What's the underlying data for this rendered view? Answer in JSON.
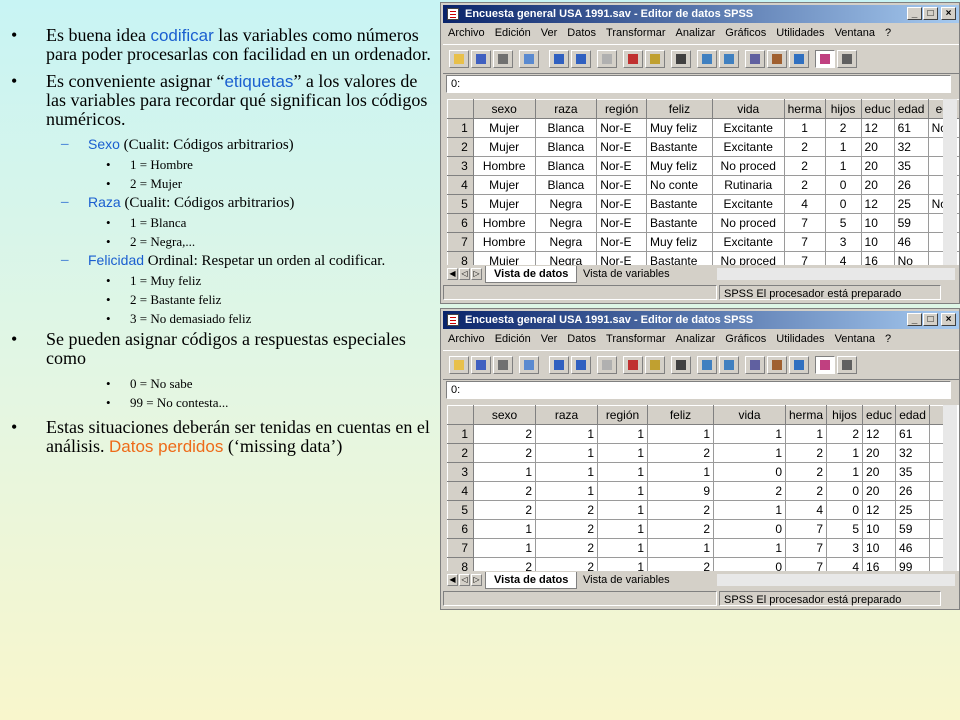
{
  "notes": {
    "p1": {
      "a": "Es buena idea ",
      "b": "codificar",
      "c": " las variables como números para poder procesarlas con facilidad en un ordenador."
    },
    "p2": {
      "a": "Es conveniente asignar “",
      "b": "etiquetas",
      "c": "” a los valores de las variables para recordar qué significan los códigos numéricos."
    },
    "sexo": {
      "name": "Sexo",
      "rest": " (Cualit: Códigos arbitrarios)",
      "v1": "1 = Hombre",
      "v2": "2 = Mujer"
    },
    "raza": {
      "name": "Raza",
      "rest": " (Cualit: Códigos arbitrarios)",
      "v1": "1 = Blanca",
      "v2": "2 = Negra,..."
    },
    "feliz": {
      "name": "Felicidad",
      "rest": " Ordinal: Respetar un orden al codificar.",
      "v1": "1 = Muy feliz",
      "v2": "2 = Bastante feliz",
      "v3": "3 = No demasiado feliz"
    },
    "p3": "Se pueden asignar códigos a respuestas especiales como",
    "p3v1": "0 = No sabe",
    "p3v2": "99 = No contesta...",
    "p4": {
      "a": "Estas situaciones deberán ser tenidas en cuentas en el análisis. ",
      "b": "Datos perdidos",
      "c": " (‘missing data’)"
    }
  },
  "window": {
    "title": "Encuesta general USA 1991.sav - Editor de datos SPSS",
    "menus": [
      "Archivo",
      "Edición",
      "Ver",
      "Datos",
      "Transformar",
      "Analizar",
      "Gráficos",
      "Utilidades",
      "Ventana",
      "?"
    ],
    "cell_ref": "0:",
    "tab_data": "Vista de datos",
    "tab_vars": "Vista de variables",
    "status": "SPSS El procesador  está preparado",
    "buttons": {
      "min": "_",
      "max": "□",
      "close": "×"
    }
  },
  "columns": [
    "sexo",
    "raza",
    "región",
    "feliz",
    "vida",
    "herma",
    "hijos",
    "educ",
    "edad",
    "ed-"
  ],
  "columns2": [
    "sexo",
    "raza",
    "región",
    "feliz",
    "vida",
    "herma",
    "hijos",
    "educ",
    "edad",
    ""
  ],
  "rows_labels": [
    [
      "1",
      "Mujer",
      "Blanca",
      "Nor-E",
      "Muy feliz",
      "Excitante",
      "1",
      "2",
      "12",
      "61",
      "No p"
    ],
    [
      "2",
      "Mujer",
      "Blanca",
      "Nor-E",
      "Bastante",
      "Excitante",
      "2",
      "1",
      "20",
      "32",
      ""
    ],
    [
      "3",
      "Hombre",
      "Blanca",
      "Nor-E",
      "Muy feliz",
      "No proced",
      "2",
      "1",
      "20",
      "35",
      ""
    ],
    [
      "4",
      "Mujer",
      "Blanca",
      "Nor-E",
      "No conte",
      "Rutinaria",
      "2",
      "0",
      "20",
      "26",
      ""
    ],
    [
      "5",
      "Mujer",
      "Negra",
      "Nor-E",
      "Bastante",
      "Excitante",
      "4",
      "0",
      "12",
      "25",
      "No"
    ],
    [
      "6",
      "Hombre",
      "Negra",
      "Nor-E",
      "Bastante",
      "No proced",
      "7",
      "5",
      "10",
      "59",
      ""
    ],
    [
      "7",
      "Hombre",
      "Negra",
      "Nor-E",
      "Muy feliz",
      "Excitante",
      "7",
      "3",
      "10",
      "46",
      ""
    ],
    [
      "8",
      "Mujer",
      "Negra",
      "Nor-E",
      "Bastante",
      "No proced",
      "7",
      "4",
      "16",
      "No",
      ""
    ]
  ],
  "rows_codes": [
    [
      "1",
      "2",
      "1",
      "1",
      "1",
      "1",
      "1",
      "2",
      "12",
      "61",
      ""
    ],
    [
      "2",
      "2",
      "1",
      "1",
      "2",
      "1",
      "2",
      "1",
      "20",
      "32",
      ""
    ],
    [
      "3",
      "1",
      "1",
      "1",
      "1",
      "0",
      "2",
      "1",
      "20",
      "35",
      ""
    ],
    [
      "4",
      "2",
      "1",
      "1",
      "9",
      "2",
      "2",
      "0",
      "20",
      "26",
      ""
    ],
    [
      "5",
      "2",
      "2",
      "1",
      "2",
      "1",
      "4",
      "0",
      "12",
      "25",
      ""
    ],
    [
      "6",
      "1",
      "2",
      "1",
      "2",
      "0",
      "7",
      "5",
      "10",
      "59",
      ""
    ],
    [
      "7",
      "1",
      "2",
      "1",
      "1",
      "1",
      "7",
      "3",
      "10",
      "46",
      ""
    ],
    [
      "8",
      "2",
      "2",
      "1",
      "2",
      "0",
      "7",
      "4",
      "16",
      "99",
      ""
    ]
  ],
  "toolbar_icons": [
    "open-icon",
    "save-icon",
    "print-icon",
    "dialog-recall-icon",
    "undo-icon",
    "redo-icon",
    "chart-builder-icon",
    "goto-case-icon",
    "variables-icon",
    "find-icon",
    "insert-case-icon",
    "insert-variable-icon",
    "split-file-icon",
    "weight-cases-icon",
    "select-cases-icon",
    "value-labels-icon",
    "use-sets-icon"
  ]
}
